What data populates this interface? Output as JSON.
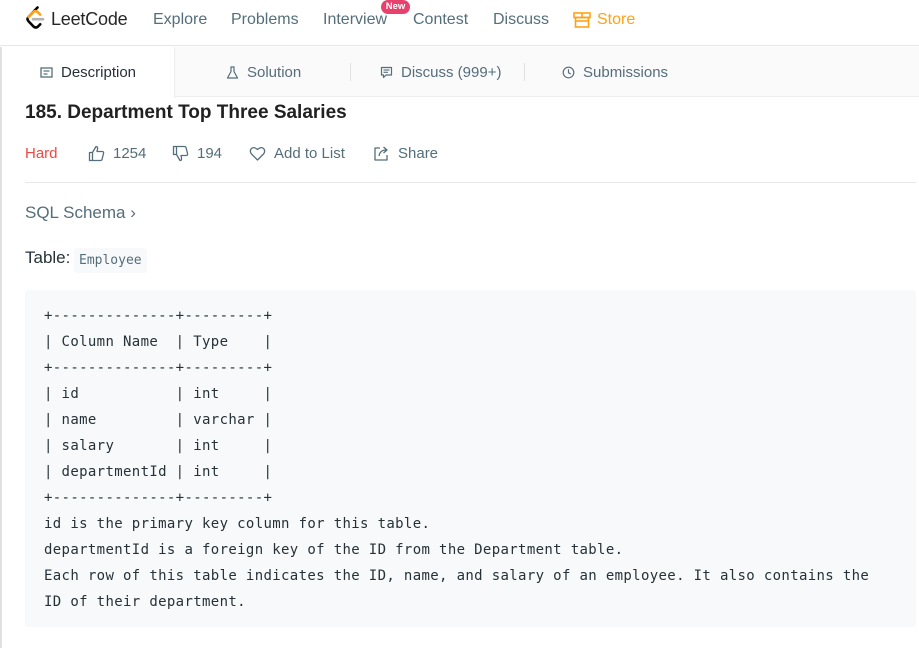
{
  "nav": {
    "logo_text": "LeetCode",
    "items": [
      "Explore",
      "Problems",
      "Interview",
      "Contest",
      "Discuss",
      "Store"
    ],
    "new_badge": "New"
  },
  "tabs": [
    {
      "label": "Description",
      "icon": "description-icon"
    },
    {
      "label": "Solution",
      "icon": "flask-icon"
    },
    {
      "label": "Discuss (999+)",
      "icon": "discuss-icon"
    },
    {
      "label": "Submissions",
      "icon": "clock-icon"
    }
  ],
  "problem": {
    "title": "185. Department Top Three Salaries",
    "difficulty": "Hard",
    "likes": "1254",
    "dislikes": "194",
    "add_to_list": "Add to List",
    "share": "Share"
  },
  "schema": {
    "link": "SQL Schema ›",
    "table_label": "Table:",
    "table_name": "Employee"
  },
  "code_lines": [
    "+--------------+---------+",
    "| Column Name  | Type    |",
    "+--------------+---------+",
    "| id           | int     |",
    "| name         | varchar |",
    "| salary       | int     |",
    "| departmentId | int     |",
    "+--------------+---------+",
    "id is the primary key column for this table.",
    "departmentId is a foreign key of the ID from the Department table.",
    "Each row of this table indicates the ID, name, and salary of an employee. It also contains the",
    "ID of their department."
  ],
  "colors": {
    "accent": "#ffa116",
    "hard": "#ef4743",
    "new_badge": "#e8416d"
  }
}
